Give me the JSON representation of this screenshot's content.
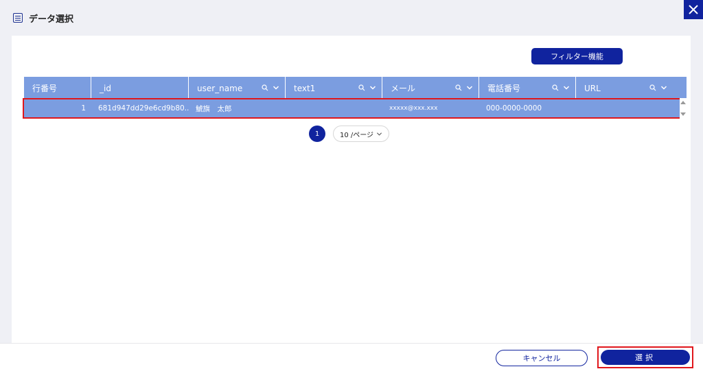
{
  "dialog": {
    "title": "データ選択",
    "icon": "table-list-icon",
    "close_icon": "close-icon"
  },
  "toolbar": {
    "filter_label": "フィルター機能"
  },
  "table": {
    "columns": [
      {
        "label": "行番号",
        "searchable": false
      },
      {
        "label": "_id",
        "searchable": false
      },
      {
        "label": "user_name",
        "searchable": true
      },
      {
        "label": "text1",
        "searchable": true
      },
      {
        "label": "メール",
        "searchable": true
      },
      {
        "label": "電話番号",
        "searchable": true
      },
      {
        "label": "URL",
        "searchable": true
      }
    ],
    "rows": [
      {
        "row_number": "1",
        "id": "681d947dd29e6cd9b80...",
        "user_name": "鯱旗　太郎",
        "text1": "",
        "email": "xxxxx@xxx.xxx",
        "phone": "000-0000-0000",
        "url": ""
      }
    ]
  },
  "pagination": {
    "current_page": "1",
    "page_size_label": "10 /ページ"
  },
  "footer": {
    "cancel_label": "キャンセル",
    "select_label": "選択"
  },
  "colors": {
    "accent": "#10239e",
    "header_bg": "#7b9de0",
    "highlight": "#e0161b"
  }
}
